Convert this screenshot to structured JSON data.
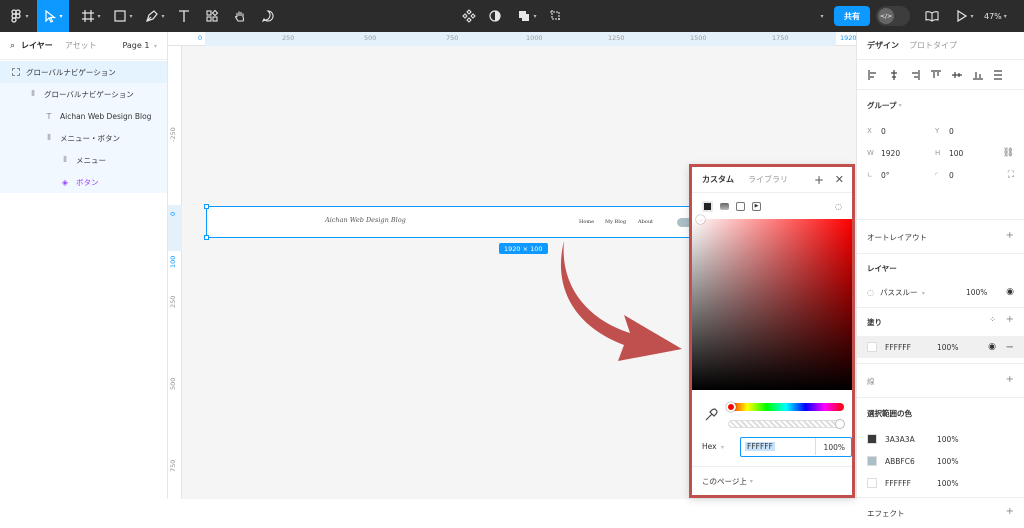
{
  "toolbar": {
    "share_label": "共有",
    "zoom": "47%"
  },
  "left": {
    "tab_layers": "レイヤー",
    "tab_assets": "アセット",
    "page_label": "Page 1",
    "layers": [
      {
        "name": "グローバルナビゲーション",
        "icon": "frame-icon"
      },
      {
        "name": "グローバルナビゲーション",
        "icon": "auto-layout-icon"
      },
      {
        "name": "Aichan Web Design Blog",
        "icon": "text-icon"
      },
      {
        "name": "メニュー・ボタン",
        "icon": "auto-layout-icon"
      },
      {
        "name": "メニュー",
        "icon": "auto-layout-icon"
      },
      {
        "name": "ボタン",
        "icon": "component-icon"
      }
    ]
  },
  "canvas": {
    "ruler_top": [
      "0",
      "250",
      "500",
      "750",
      "1000",
      "1250",
      "1500",
      "1750",
      "1920"
    ],
    "ruler_left": [
      "-250",
      "0",
      "100",
      "250",
      "500",
      "750"
    ],
    "frame_logo": "Aichan Web Design Blog",
    "frame_nav": [
      "Home",
      "My Blog",
      "About"
    ],
    "size_badge": "1920 × 100"
  },
  "picker": {
    "tab_custom": "カスタム",
    "tab_library": "ライブラリ",
    "format": "Hex",
    "hex": "FFFFFF",
    "opacity": "100%",
    "footer": "このページ上"
  },
  "right": {
    "tab_design": "デザイン",
    "tab_prototype": "プロトタイプ",
    "group_title": "グループ",
    "x_label": "X",
    "x": "0",
    "y_label": "Y",
    "y": "0",
    "w_label": "W",
    "w": "1920",
    "h_label": "H",
    "h": "100",
    "rotation": "0°",
    "radius": "0",
    "auto_layout": "オートレイアウト",
    "layer_title": "レイヤー",
    "blend": "パススルー",
    "layer_opacity": "100%",
    "fill_title": "塗り",
    "fill_hex": "FFFFFF",
    "fill_opacity": "100%",
    "stroke_title": "線",
    "selection_colors_title": "選択範囲の色",
    "selection_colors": [
      {
        "hex": "3A3A3A",
        "opacity": "100%",
        "color": "#3A3A3A"
      },
      {
        "hex": "ABBFC6",
        "opacity": "100%",
        "color": "#ABBFC6"
      },
      {
        "hex": "FFFFFF",
        "opacity": "100%",
        "color": "#FFFFFF"
      }
    ],
    "effects_title": "エフェクト"
  }
}
